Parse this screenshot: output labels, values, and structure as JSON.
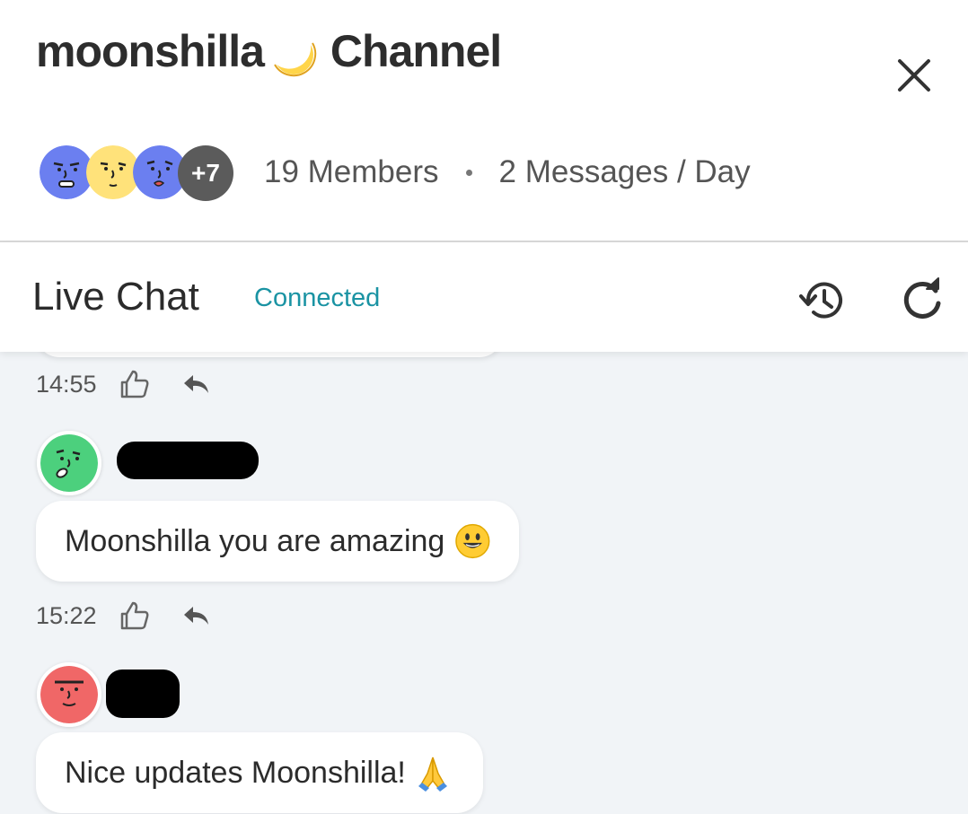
{
  "header": {
    "channel_name": "moonshilla",
    "moon_icon": "crescent-moon-emoji",
    "channel_suffix": "Channel",
    "close_icon": "close-icon"
  },
  "members": {
    "more_count": "+7",
    "members_text": "19 Members",
    "messages_text": "2 Messages / Day"
  },
  "chat": {
    "title": "Live Chat",
    "status": "Connected",
    "status_color": "#1a93a3",
    "history_icon": "history-icon",
    "refresh_icon": "refresh-icon"
  },
  "messages": [
    {
      "time": "14:55"
    },
    {
      "text": "Moonshilla you are amazing",
      "emoji": "grinning-face-emoji",
      "time": "15:22",
      "avatar_color": "#4cd07d"
    },
    {
      "text": "Nice updates Moonshilla!",
      "emoji": "folded-hands-emoji",
      "avatar_color": "#f06767"
    }
  ],
  "colors": {
    "avatar_blue": "#6b7ff0",
    "avatar_yellow": "#ffe27a",
    "chat_bg": "#f1f4f7"
  }
}
